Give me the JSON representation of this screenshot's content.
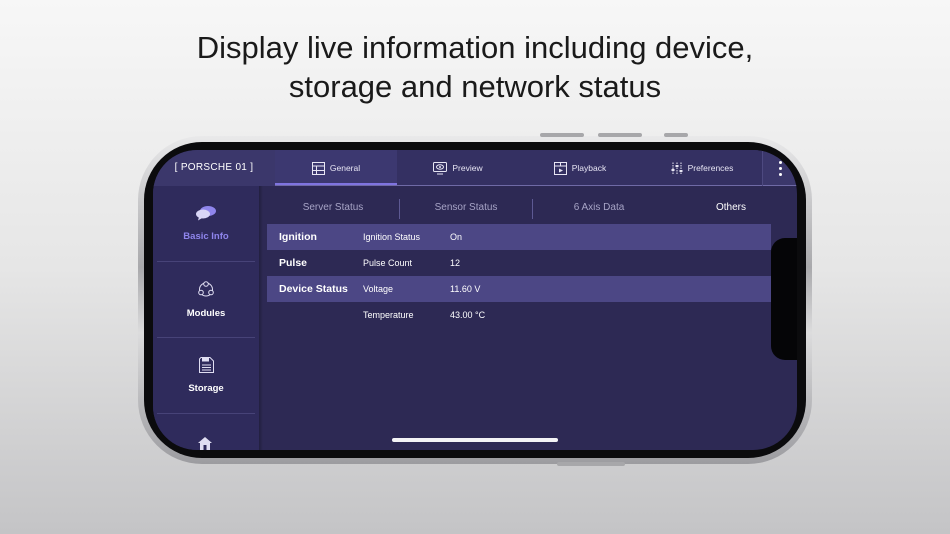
{
  "headline": {
    "line1": "Display live information including device,",
    "line2": "storage and network status"
  },
  "app": {
    "device_name": "[ PORSCHE 01 ]",
    "tabs": [
      {
        "label": "General",
        "icon": "grid-icon",
        "active": true
      },
      {
        "label": "Preview",
        "icon": "monitor-eye-icon",
        "active": false
      },
      {
        "label": "Playback",
        "icon": "video-grid-icon",
        "active": false
      },
      {
        "label": "Preferences",
        "icon": "sliders-icon",
        "active": false
      }
    ],
    "sidebar": {
      "items": [
        {
          "label": "Basic Info",
          "icon": "chat-bubbles-icon",
          "active": true
        },
        {
          "label": "Modules",
          "icon": "modules-icon",
          "active": false
        },
        {
          "label": "Storage",
          "icon": "storage-icon",
          "active": false
        },
        {
          "label": "",
          "icon": "house-icon",
          "active": false
        }
      ]
    },
    "subtabs": [
      {
        "label": "Server Status",
        "active": false
      },
      {
        "label": "Sensor Status",
        "active": false
      },
      {
        "label": "6 Axis Data",
        "active": false
      },
      {
        "label": "Others",
        "active": true
      }
    ],
    "rows": [
      {
        "group": "Ignition",
        "label": "Ignition Status",
        "value": "On",
        "highlight": true
      },
      {
        "group": "Pulse",
        "label": "Pulse Count",
        "value": "12",
        "highlight": false
      },
      {
        "group": "Device Status",
        "label": "Voltage",
        "value": "11.60 V",
        "highlight": true
      },
      {
        "group": "",
        "label": "Temperature",
        "value": "43.00 °C",
        "highlight": false
      }
    ]
  },
  "colors": {
    "accent": "#7f74e0",
    "background": "#2d2954",
    "row_highlight": "#4c4785"
  }
}
